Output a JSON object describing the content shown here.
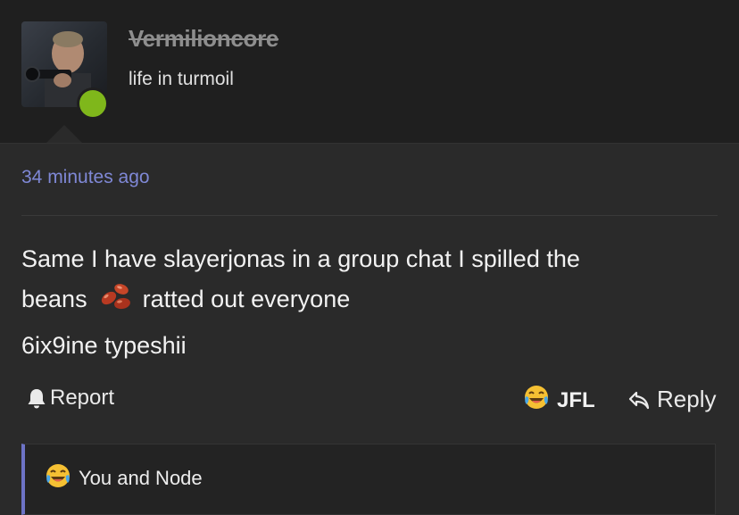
{
  "user": {
    "username": "Vermilioncore",
    "user_title": "life in turmoil",
    "online_status_color": "#7fb71b"
  },
  "post": {
    "timestamp": "34 minutes ago",
    "message_line1": "Same I have slayerjonas in a group chat I spilled the",
    "message_line2_before": "beans",
    "message_inline_icon": "beans-emoji",
    "message_line2_after": "ratted out everyone",
    "message_line3": "6ix9ine typeshii"
  },
  "actions": {
    "report_label": "Report",
    "reaction_label": "JFL",
    "reaction_icon": "crying-laughing-emoji",
    "reply_label": "Reply"
  },
  "reactions_summary": {
    "icon": "crying-laughing-emoji",
    "text": "You and Node"
  },
  "colors": {
    "accent": "#7f88d6",
    "quote_bar": "#6d73c6",
    "background": "#2a2a2a",
    "header_background": "#1f1f1f"
  }
}
